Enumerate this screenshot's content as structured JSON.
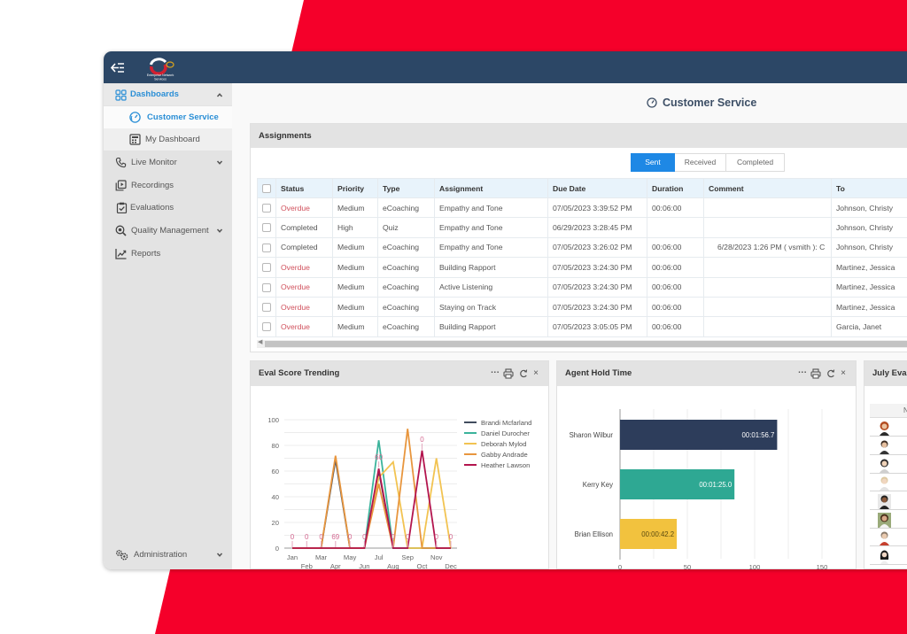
{
  "app": {
    "logo_text_line1": "Enterprise Network",
    "logo_text_line2": "Services",
    "colors": {
      "topbar": "#2c4766",
      "accent_blue": "#2b8fd6",
      "backdrop_red": "#f5002a"
    }
  },
  "topbar": {
    "menu_icon": "collapse-menu-icon"
  },
  "sidebar": {
    "items": [
      {
        "label": "Dashboards",
        "icon": "dashboard-grid-icon",
        "state": "expanded"
      },
      {
        "label": "Customer Service",
        "icon": "speedometer-icon",
        "state": "active"
      },
      {
        "label": "My Dashboard",
        "icon": "calculator-icon"
      },
      {
        "label": "Live Monitor",
        "icon": "phone-icon",
        "state": "collapsed"
      },
      {
        "label": "Recordings",
        "icon": "play-library-icon"
      },
      {
        "label": "Evaluations",
        "icon": "clipboard-check-icon"
      },
      {
        "label": "Quality Management",
        "icon": "search-analytics-icon",
        "state": "collapsed"
      },
      {
        "label": "Reports",
        "icon": "line-chart-icon"
      }
    ],
    "footer": {
      "label": "Administration",
      "icon": "gears-icon",
      "state": "collapsed"
    }
  },
  "page": {
    "title": "Customer Service",
    "title_icon": "speedometer-icon"
  },
  "assignments": {
    "title": "Assignments",
    "filters": [
      {
        "label": "Sent",
        "selected": true
      },
      {
        "label": "Received",
        "selected": false
      },
      {
        "label": "Completed",
        "selected": false
      }
    ],
    "columns": [
      "Status",
      "Priority",
      "Type",
      "Assignment",
      "Due Date",
      "Duration",
      "Comment",
      "To"
    ],
    "status_colors": {
      "Overdue": "#d0505c",
      "Completed": "#555555"
    },
    "rows": [
      {
        "status": "Overdue",
        "priority": "Medium",
        "type": "eCoaching",
        "assignment": "Empathy and Tone",
        "due": "07/05/2023 3:39:52 PM",
        "duration": "00:06:00",
        "comment": "",
        "to": "Johnson, Christy"
      },
      {
        "status": "Completed",
        "priority": "High",
        "type": "Quiz",
        "assignment": "Empathy and Tone",
        "due": "06/29/2023 3:28:45 PM",
        "duration": "",
        "comment": "",
        "to": "Johnson, Christy"
      },
      {
        "status": "Completed",
        "priority": "Medium",
        "type": "eCoaching",
        "assignment": "Empathy and Tone",
        "due": "07/05/2023 3:26:02 PM",
        "duration": "00:06:00",
        "comment": "6/28/2023 1:26 PM ( vsmith ): C",
        "to": "Johnson, Christy"
      },
      {
        "status": "Overdue",
        "priority": "Medium",
        "type": "eCoaching",
        "assignment": "Building Rapport",
        "due": "07/05/2023 3:24:30 PM",
        "duration": "00:06:00",
        "comment": "",
        "to": "Martinez, Jessica"
      },
      {
        "status": "Overdue",
        "priority": "Medium",
        "type": "eCoaching",
        "assignment": "Active Listening",
        "due": "07/05/2023 3:24:30 PM",
        "duration": "00:06:00",
        "comment": "",
        "to": "Martinez, Jessica"
      },
      {
        "status": "Overdue",
        "priority": "Medium",
        "type": "eCoaching",
        "assignment": "Staying on Track",
        "due": "07/05/2023 3:24:30 PM",
        "duration": "00:06:00",
        "comment": "",
        "to": "Martinez, Jessica"
      },
      {
        "status": "Overdue",
        "priority": "Medium",
        "type": "eCoaching",
        "assignment": "Building Rapport",
        "due": "07/05/2023 3:05:05 PM",
        "duration": "00:06:00",
        "comment": "",
        "to": "Garcia, Janet"
      }
    ]
  },
  "widgets": {
    "controls": {
      "more": "...",
      "print_icon": "printer-icon",
      "refresh_icon": "refresh-icon",
      "close": "×"
    },
    "july_eval": {
      "title": "July Eval",
      "column_header": "N",
      "avatar_count": 8
    }
  },
  "chart_data": [
    {
      "type": "line",
      "title": "Eval Score Trending",
      "xlabel": "",
      "ylabel": "",
      "categories": [
        "Jan",
        "Feb",
        "Mar",
        "Apr",
        "May",
        "Jun",
        "Jul",
        "Aug",
        "Sep",
        "Oct",
        "Nov",
        "Dec"
      ],
      "ylim": [
        0,
        100
      ],
      "yticks": [
        0,
        20,
        40,
        60,
        80,
        100
      ],
      "grid": true,
      "legend": "right",
      "series": [
        {
          "name": "Brandi Mcfarland",
          "color": "#414c5e",
          "values": [
            0,
            0,
            0,
            69,
            0,
            0,
            60,
            0,
            0,
            0,
            0,
            0
          ]
        },
        {
          "name": "Daniel Durocher",
          "color": "#3bb39b",
          "values": [
            0,
            0,
            0,
            0,
            0,
            0,
            84,
            0,
            0,
            0,
            0,
            0
          ]
        },
        {
          "name": "Deborah Mylod",
          "color": "#f2c351",
          "values": [
            0,
            0,
            0,
            0,
            0,
            0,
            55,
            67,
            0,
            0,
            70,
            0
          ]
        },
        {
          "name": "Gabby Andrade",
          "color": "#e8963e",
          "values": [
            0,
            0,
            0,
            72,
            0,
            0,
            50,
            0,
            93,
            0,
            0,
            0
          ]
        },
        {
          "name": "Heather Lawson",
          "color": "#b3154e",
          "values": [
            0,
            0,
            0,
            0,
            0,
            0,
            62,
            0,
            0,
            76,
            0,
            0
          ]
        }
      ],
      "data_labels": [
        {
          "x": "Jan",
          "text": "0",
          "at": 0
        },
        {
          "x": "Feb",
          "text": "0",
          "at": 0
        },
        {
          "x": "Mar",
          "text": "0",
          "at": 0
        },
        {
          "x": "Apr",
          "text": "69",
          "at": 0
        },
        {
          "x": "May",
          "text": "0",
          "at": 0
        },
        {
          "x": "Jun",
          "text": "0",
          "at": 0
        },
        {
          "x": "Jul",
          "text": "60",
          "at": 62
        },
        {
          "x": "Aug",
          "text": "0",
          "at": 0
        },
        {
          "x": "Sep",
          "text": "0",
          "at": 0
        },
        {
          "x": "Oct",
          "text": "0",
          "at": 76
        },
        {
          "x": "Nov",
          "text": "0",
          "at": 0
        },
        {
          "x": "Dec",
          "text": "0",
          "at": 0
        }
      ]
    },
    {
      "type": "bar",
      "orientation": "horizontal",
      "title": "Agent Hold Time",
      "xlabel": "",
      "ylabel": "",
      "categories": [
        "Sharon Wilbur",
        "Kerry Key",
        "Brian Ellison"
      ],
      "values": [
        116.7,
        85.0,
        42.2
      ],
      "value_labels": [
        "00:01:56.7",
        "00:01:25.0",
        "00:00:42.2"
      ],
      "colors": [
        "#2d3d5b",
        "#2ea893",
        "#f2c23e"
      ],
      "label_colors": [
        "#ffffff",
        "#ffffff",
        "#5a4a10"
      ],
      "xlim": [
        0,
        170
      ],
      "xticks": [
        0,
        50,
        100,
        150
      ],
      "grid": true,
      "legend": "none"
    }
  ]
}
